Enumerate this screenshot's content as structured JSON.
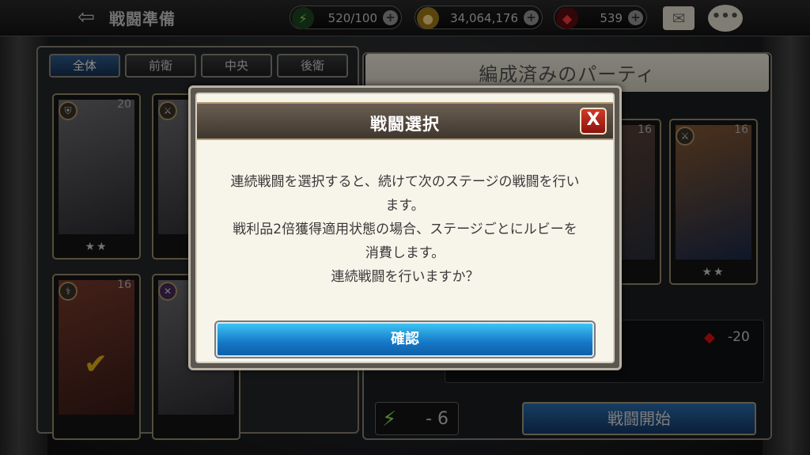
{
  "header": {
    "back_glyph": "⇦",
    "title": "戦闘準備",
    "stamina": "520/100",
    "gold": "34,064,176",
    "rubies": "539"
  },
  "tabs": [
    "全体",
    "前衛",
    "中央",
    "後衛"
  ],
  "roster": [
    {
      "level": "20",
      "stars": "★★"
    },
    {
      "level": "",
      "stars": ""
    },
    {
      "level": "16",
      "stars": ""
    },
    {
      "level": "",
      "stars": ""
    }
  ],
  "party": {
    "title": "編成済みのパーティ",
    "members": [
      {
        "level": "16",
        "stars": "★"
      },
      {
        "level": "16",
        "stars": "★★"
      }
    ],
    "ruby_cost": "-20",
    "stamina_cost": "- 6",
    "start_button": "戦闘開始"
  },
  "dialog": {
    "title": "戦闘選択",
    "close": "X",
    "lines": [
      "連続戦闘を選択すると、続けて次のステージの戦闘を行い",
      "ます。",
      "戦利品2倍獲得適用状態の場合、ステージごとにルビーを",
      "消費します。",
      "連続戦闘を行いますか？"
    ],
    "confirm_button": "確認"
  },
  "colors": {
    "confirm_button": "#1577c8",
    "close_button": "#c0251a",
    "dialog_bg": "#f7f4ea",
    "stamina_green": "#8cf05a",
    "ruby_red": "#d11111"
  },
  "icons": {
    "back": "left-arrow-icon",
    "stamina": "lightning-icon",
    "gold": "coin-icon",
    "ruby": "ruby-gem-icon",
    "mail": "mail-icon",
    "chat": "chat-bubble-icon",
    "close": "close-icon"
  }
}
